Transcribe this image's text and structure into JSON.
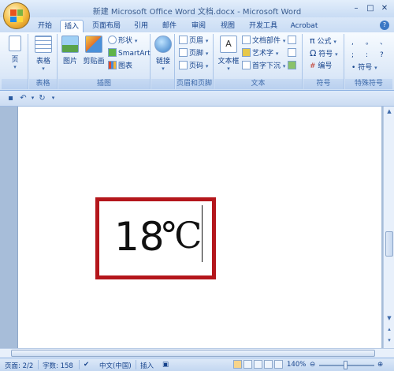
{
  "window": {
    "title": "新建 Microsoft Office Word 文档.docx - Microsoft Word",
    "minimize": "–",
    "maximize": "□",
    "close": "✕"
  },
  "tabs": [
    {
      "label": "开始"
    },
    {
      "label": "插入"
    },
    {
      "label": "页面布局"
    },
    {
      "label": "引用"
    },
    {
      "label": "邮件"
    },
    {
      "label": "审阅"
    },
    {
      "label": "视图"
    },
    {
      "label": "开发工具"
    },
    {
      "label": "Acrobat"
    }
  ],
  "active_tab": "插入",
  "ribbon": {
    "pages_group": {
      "label": "",
      "page_btn": "页"
    },
    "table_group": {
      "label": "表格",
      "table_btn": "表格"
    },
    "illustrations_group": {
      "label": "插图",
      "picture": "图片",
      "clipart": "剪贴画",
      "shapes": "形状",
      "smartart": "SmartArt",
      "chart": "图表"
    },
    "links_group": {
      "label": "",
      "links": "链接"
    },
    "header_footer_group": {
      "label": "页眉和页脚",
      "header": "页眉",
      "footer": "页脚",
      "page_number": "页码"
    },
    "text_group": {
      "label": "文本",
      "textbox": "文本框",
      "quickparts": "文档部件",
      "wordart": "艺术字",
      "dropcap": "首字下沉"
    },
    "symbols_group": {
      "label": "符号",
      "equation": "公式",
      "symbol": "符号",
      "numbering": "编号"
    },
    "special_group": {
      "label": "特殊符号",
      "symbol": "符号",
      "chars": [
        ",",
        "。",
        "、",
        ";",
        ":",
        "?"
      ]
    }
  },
  "document": {
    "temperature": "18",
    "unit": "℃"
  },
  "status": {
    "page": "页面: 2/2",
    "words": "字数: 158",
    "language": "中文(中国)",
    "mode": "插入",
    "zoom": "140%"
  },
  "colors": {
    "highlight": "#b4161b",
    "ribbon_text": "#15428b"
  }
}
